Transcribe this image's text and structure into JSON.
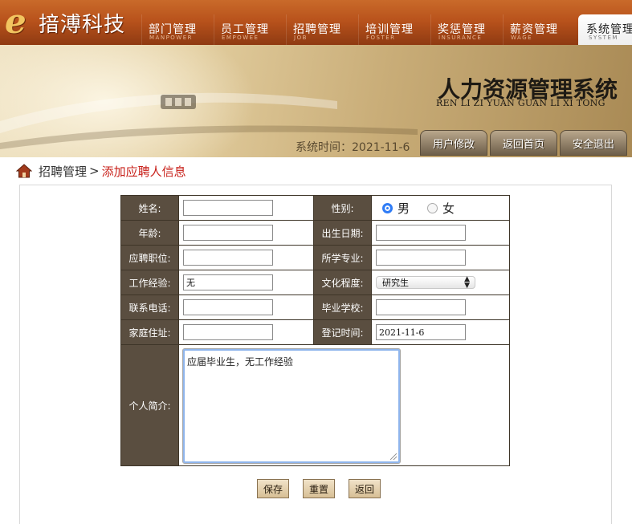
{
  "brand": {
    "logo_letter": "e",
    "name": "揞溥科技"
  },
  "nav": [
    {
      "zh": "部门管理",
      "en": "MANPOWER",
      "active": false
    },
    {
      "zh": "员工管理",
      "en": "EMPOWEE",
      "active": false
    },
    {
      "zh": "招聘管理",
      "en": "JOB",
      "active": false
    },
    {
      "zh": "培训管理",
      "en": "FOSTER",
      "active": false
    },
    {
      "zh": "奖惩管理",
      "en": "INSURANCE",
      "active": false
    },
    {
      "zh": "薪资管理",
      "en": "WAGE",
      "active": false
    },
    {
      "zh": "系统管理",
      "en": "SYSTEM",
      "active": true
    }
  ],
  "banner": {
    "title": "人力资源管理系统",
    "subtitle": "REN LI ZI YUAN GUAN LI XI TONG",
    "system_time": "系统时间：2021-11-6",
    "buttons": [
      "用户修改",
      "返回首页",
      "安全退出"
    ]
  },
  "breadcrumb": {
    "parent": "招聘管理",
    "separator": ">",
    "current": "添加应聘人信息"
  },
  "form": {
    "labels": {
      "name": "姓名:",
      "gender": "性别:",
      "age": "年龄:",
      "birth": "出生日期:",
      "position": "应聘职位:",
      "major": "所学专业:",
      "experience": "工作经验:",
      "education": "文化程度:",
      "phone": "联系电话:",
      "school": "毕业学校:",
      "address": "家庭住址:",
      "register_time": "登记时间:",
      "intro": "个人简介:"
    },
    "values": {
      "name": "",
      "age": "",
      "birth": "",
      "position": "",
      "major": "",
      "experience": "无",
      "education": "研究生",
      "phone": "",
      "school": "",
      "address": "",
      "register_time": "2021-11-6",
      "intro": "应届毕业生，无工作经验"
    },
    "gender_options": [
      "男",
      "女"
    ],
    "gender_selected": "男"
  },
  "actions": {
    "save": "保存",
    "reset": "重置",
    "back": "返回"
  },
  "colors": {
    "label_bg": "#5a4e40",
    "accent_red": "#c8201a",
    "radio_blue": "#2f7cf6",
    "nav_orange": "#b9531c"
  }
}
